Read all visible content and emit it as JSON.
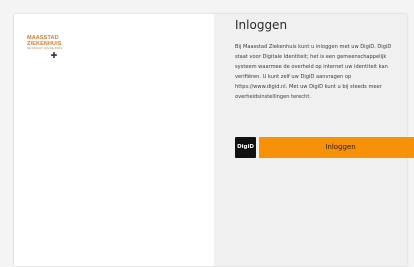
{
  "logo": {
    "line1": "MAASSTAD",
    "line2": "ZIEKENHUIS",
    "tagline": "DE KRACHT VAN DE ZORG",
    "cross": "✚"
  },
  "login": {
    "title": "Inloggen",
    "intro": "Bij Maasstad Ziekenhuis kunt u inloggen met uw DigiD. DigiD staat voor Digitale Identiteit; het is een gemeenschappelijk systeem waarmee de overheid op internet uw identiteit kan verifiëren. U kunt zelf uw DigiD aanvragen op https://www.digid.nl. Met uw DigiD kunt u bij steeds meer overheidsinstellingen terecht.",
    "digid_logo_text": "DigiD",
    "button_label": "Inloggen"
  },
  "colors": {
    "button": "#f7910a",
    "logo_orange": "#e2782a",
    "right_panel": "#f0f0f0"
  }
}
